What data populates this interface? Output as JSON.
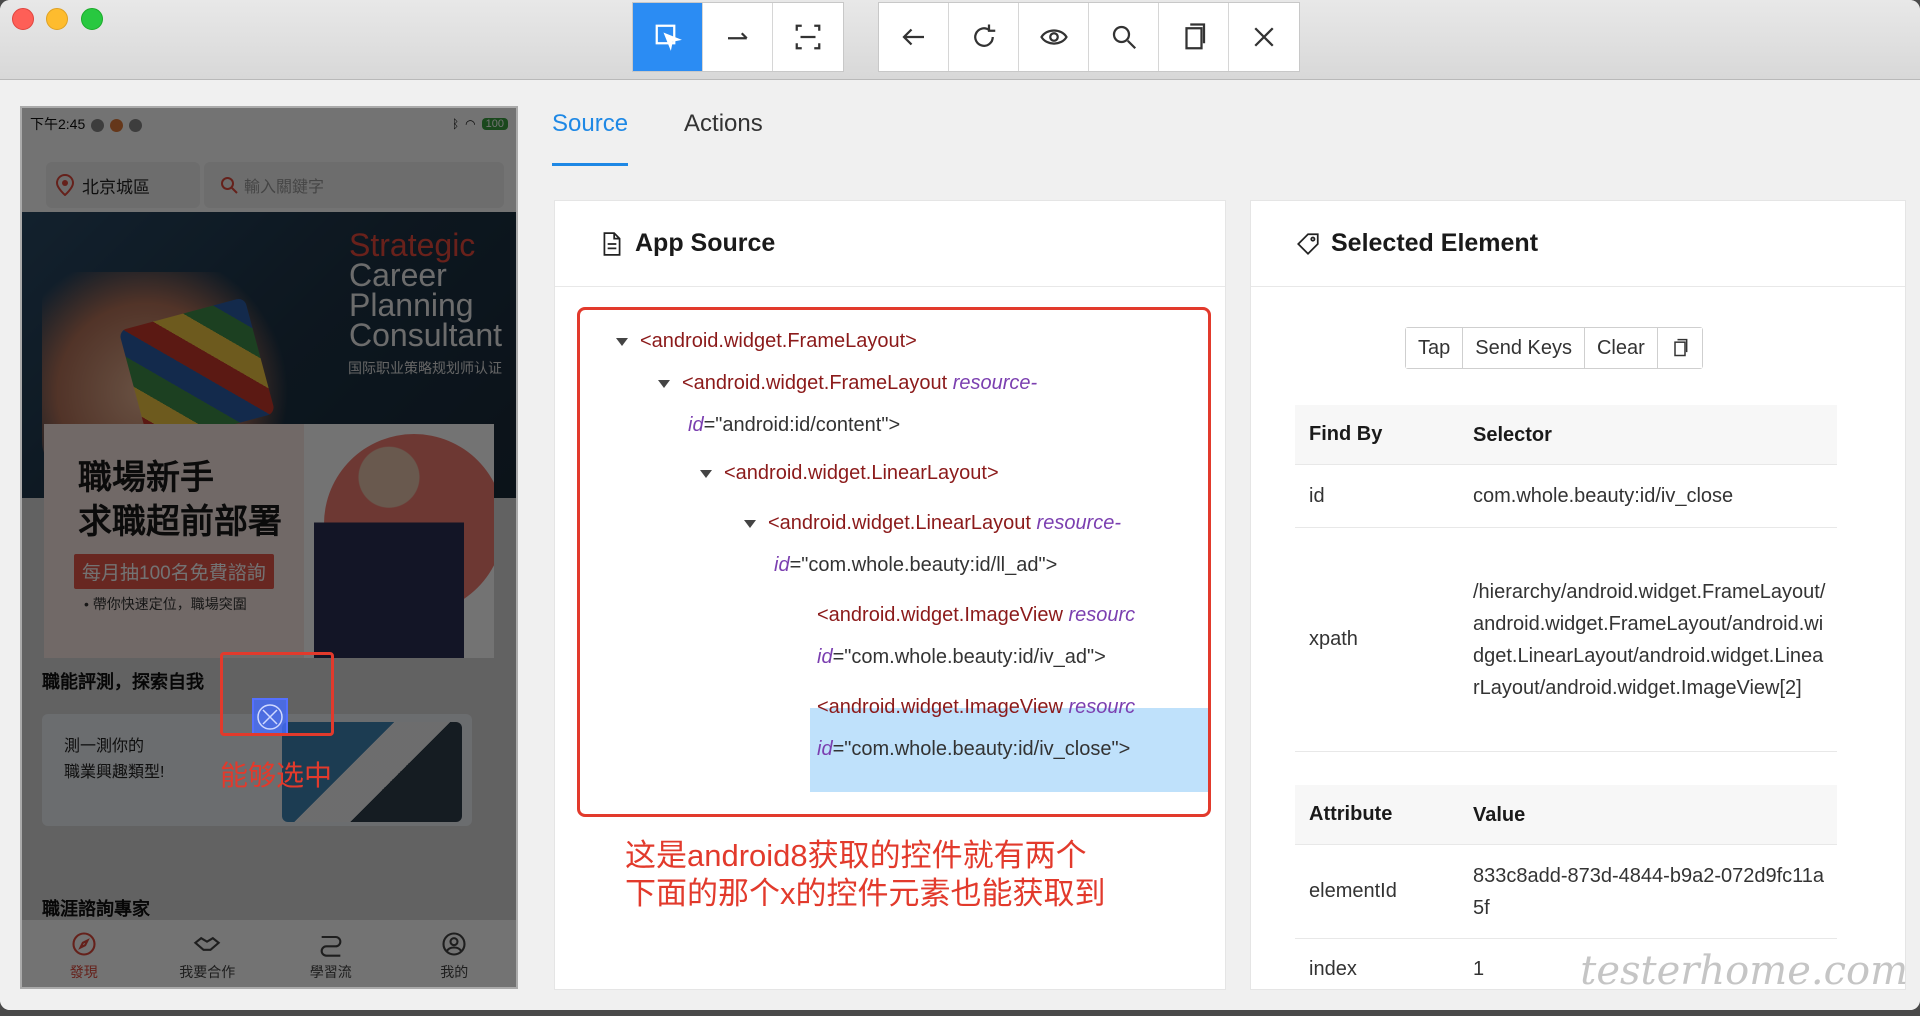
{
  "toolbar": {
    "group1": [
      {
        "name": "select-element-icon",
        "active": true
      },
      {
        "name": "swipe-icon",
        "active": false
      },
      {
        "name": "tap-coordinates-icon",
        "active": false
      }
    ],
    "group2": [
      {
        "name": "back-arrow-icon"
      },
      {
        "name": "refresh-icon"
      },
      {
        "name": "eye-icon"
      },
      {
        "name": "search-icon"
      },
      {
        "name": "copy-icon"
      },
      {
        "name": "close-icon"
      }
    ]
  },
  "phone": {
    "time": "下午2:45",
    "battery": "100",
    "location": "北京城區",
    "search_placeholder": "輸入關鍵字",
    "hero": {
      "lines": [
        "Strategic",
        "Career",
        "Planning",
        "Consultant"
      ],
      "subtitle": "国际职业策略规划师认证"
    },
    "ad": {
      "headline1": "職場新手",
      "headline2": "求職超前部署",
      "badge": "每月抽100名免費諮詢",
      "note": "• 帶你快速定位，職場突圍"
    },
    "section1": "職能評測，探索自我",
    "test_card": {
      "line1": "測一測你的",
      "line2": "職業興趣類型!"
    },
    "section2": "職涯諮詢專家",
    "nav": [
      {
        "label": "發現",
        "icon": "compass-icon",
        "active": true
      },
      {
        "label": "我要合作",
        "icon": "handshake-icon",
        "active": false
      },
      {
        "label": "學習流",
        "icon": "route-icon",
        "active": false
      },
      {
        "label": "我的",
        "icon": "user-icon",
        "active": false
      }
    ],
    "annotation": "能够选中"
  },
  "tabs": [
    {
      "label": "Source",
      "active": true
    },
    {
      "label": "Actions",
      "active": false
    }
  ],
  "source": {
    "title": "App Source",
    "nodes": [
      {
        "tag": "<android.widget.FrameLayout>",
        "attr": "",
        "val": ""
      },
      {
        "tag": "<android.widget.FrameLayout",
        "attr": "resource-",
        "val": ""
      },
      {
        "tag": "",
        "attr": "id",
        "val": "=\"android:id/content\">"
      },
      {
        "tag": "<android.widget.LinearLayout>",
        "attr": "",
        "val": ""
      },
      {
        "tag": "<android.widget.LinearLayout",
        "attr": "resource-",
        "val": ""
      },
      {
        "tag": "",
        "attr": "id",
        "val": "=\"com.whole.beauty:id/ll_ad\">"
      },
      {
        "tag": "<android.widget.ImageView",
        "attr": "resourc",
        "val": ""
      },
      {
        "tag": "",
        "attr": "id",
        "val": "=\"com.whole.beauty:id/iv_ad\">"
      },
      {
        "tag": "<android.widget.ImageView",
        "attr": "resourc",
        "val": ""
      },
      {
        "tag": "",
        "attr": "id",
        "val": "=\"com.whole.beauty:id/iv_close\">"
      }
    ],
    "note_line1": "这是android8获取的控件就有两个",
    "note_line2": "下面的那个x的控件元素也能获取到"
  },
  "element": {
    "title": "Selected Element",
    "actions": [
      "Tap",
      "Send Keys",
      "Clear"
    ],
    "find_header": {
      "k": "Find By",
      "v": "Selector"
    },
    "find_rows": [
      {
        "k": "id",
        "v": "com.whole.beauty:id/iv_close"
      },
      {
        "k": "xpath",
        "v": "/hierarchy/android.widget.FrameLayout/android.widget.FrameLayout/android.widget.LinearLayout/android.widget.LinearLayout/android.widget.ImageView[2]"
      }
    ],
    "attr_header": {
      "k": "Attribute",
      "v": "Value"
    },
    "attr_rows": [
      {
        "k": "elementId",
        "v": "833c8add-873d-4844-b9a2-072d9fc11a5f"
      },
      {
        "k": "index",
        "v": "1"
      }
    ]
  },
  "watermark": "testerhome.com"
}
